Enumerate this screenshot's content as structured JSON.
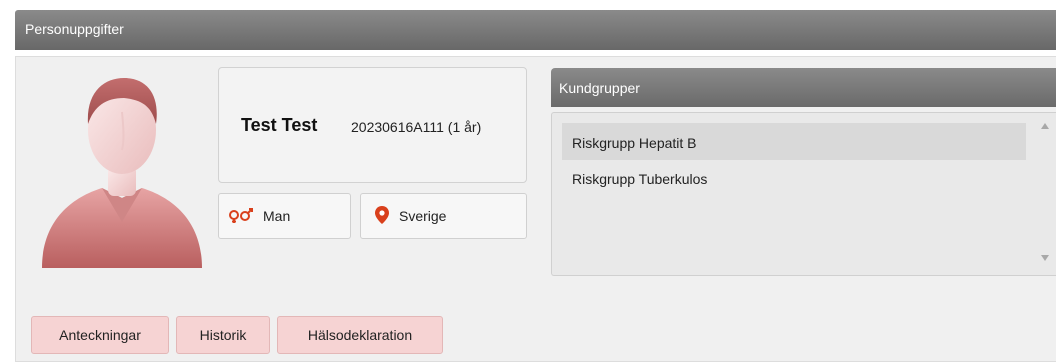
{
  "panel": {
    "title": "Personuppgifter"
  },
  "person": {
    "name": "Test Test",
    "personnummer": "20230616A111 (1 år)",
    "gender": "Man",
    "gender_icon": "gender-icon",
    "country": "Sverige",
    "country_icon": "map-pin-icon",
    "avatar_icon": "user-avatar-icon"
  },
  "kundgrupper": {
    "title": "Kundgrupper",
    "items": [
      {
        "label": "Riskgrupp Hepatit B",
        "selected": true
      },
      {
        "label": "Riskgrupp Tuberkulos",
        "selected": false
      }
    ]
  },
  "tabs": [
    {
      "label": "Anteckningar"
    },
    {
      "label": "Historik"
    },
    {
      "label": "Hälsodeklaration"
    }
  ],
  "colors": {
    "header": "#787878",
    "accent": "#d9401c",
    "avatar": "#c97a7a",
    "tab_bg": "#f6d3d3"
  }
}
